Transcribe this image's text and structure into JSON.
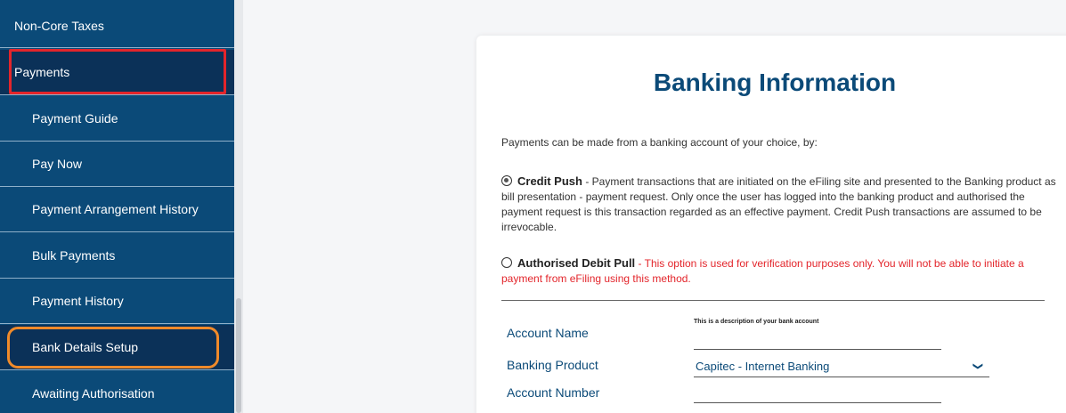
{
  "sidebar": {
    "items": [
      {
        "label": "Non-Core Taxes"
      },
      {
        "label": "Payments"
      },
      {
        "label": "Payment Guide"
      },
      {
        "label": "Pay Now"
      },
      {
        "label": "Payment Arrangement History"
      },
      {
        "label": "Bulk Payments"
      },
      {
        "label": "Payment History"
      },
      {
        "label": "Bank Details Setup"
      },
      {
        "label": "Awaiting Authorisation"
      }
    ]
  },
  "main": {
    "title": "Banking Information",
    "intro": "Payments can be made from a banking account of your choice, by:",
    "options": [
      {
        "label": "Credit Push",
        "text": "- Payment transactions that are initiated on the eFiling site and presented to the Banking product as bill presentation - payment request. Only once the user has logged into the banking product and authorised the payment request is this transaction regarded as an effective payment. Credit Push transactions are assumed to be irrevocable.",
        "selected": true
      },
      {
        "label": "Authorised Debit Pull",
        "text": "- This option is used for verification purposes only. You will not be able to initiate a payment from eFiling using this method.",
        "selected": false
      }
    ],
    "form": {
      "account_name_label": "Account Name",
      "account_name_hint": "This is a description of your bank account",
      "account_name_value": "",
      "banking_product_label": "Banking Product",
      "banking_product_value": "Capitec - Internet Banking",
      "account_number_label": "Account Number",
      "account_number_value": ""
    }
  },
  "colors": {
    "sidebar": "#0b4a78",
    "sidebar_selected": "#0b3158",
    "highlight_red": "#e3252b",
    "highlight_orange": "#f08a2a",
    "title": "#0b4a78"
  }
}
